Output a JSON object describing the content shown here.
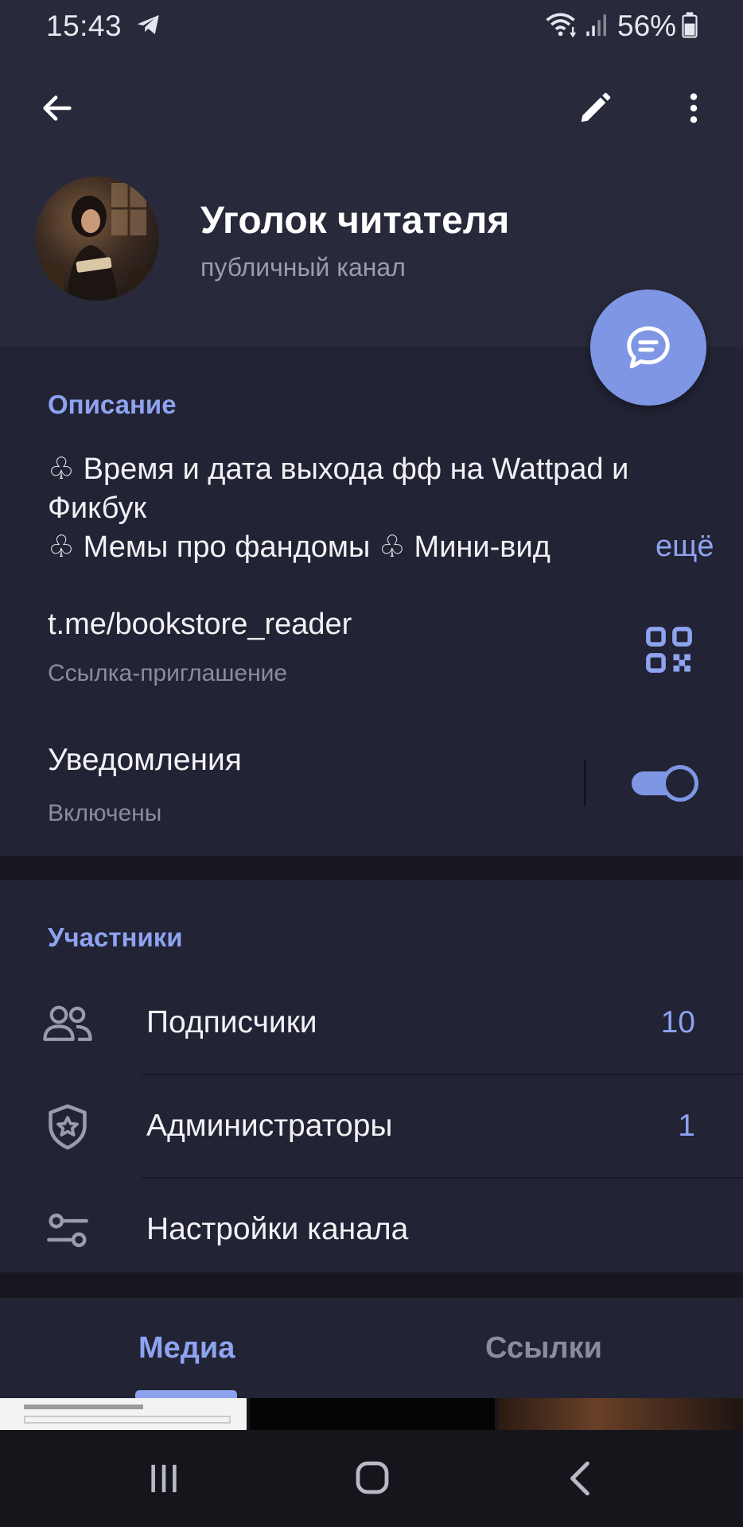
{
  "status_bar": {
    "time": "15:43",
    "battery": "56%",
    "icons": [
      "telegram-icon",
      "wifi-icon",
      "signal-icon",
      "battery-icon"
    ]
  },
  "toolbar": {
    "icons": [
      "back-arrow-icon",
      "pencil-icon",
      "more-vertical-icon"
    ]
  },
  "channel": {
    "name": "Уголок читателя",
    "type": "публичный канал"
  },
  "info": {
    "description_title": "Описание",
    "description_line1": "♧ Время и дата выхода фф на Wattpad и Фикбук",
    "description_line2": "♧ Мемы про фандомы ♧ Мини-вид",
    "more_label": "ещё",
    "link": "t.me/bookstore_reader",
    "link_caption": "Ссылка-приглашение",
    "notifications_title": "Уведомления",
    "notifications_status": "Включены",
    "notifications_enabled": true
  },
  "members": {
    "title": "Участники",
    "rows": [
      {
        "label": "Подписчики",
        "value": "10",
        "icon": "people-icon"
      },
      {
        "label": "Администраторы",
        "value": "1",
        "icon": "shield-star-icon"
      },
      {
        "label": "Настройки канала",
        "value": "",
        "icon": "sliders-icon"
      }
    ]
  },
  "tabs": [
    {
      "label": "Медиа",
      "active": true
    },
    {
      "label": "Ссылки",
      "active": false
    }
  ],
  "colors": {
    "accent": "#8ea3f0",
    "fab": "#7f96e4",
    "header_bg": "#282a3b",
    "section_bg": "#222334"
  }
}
